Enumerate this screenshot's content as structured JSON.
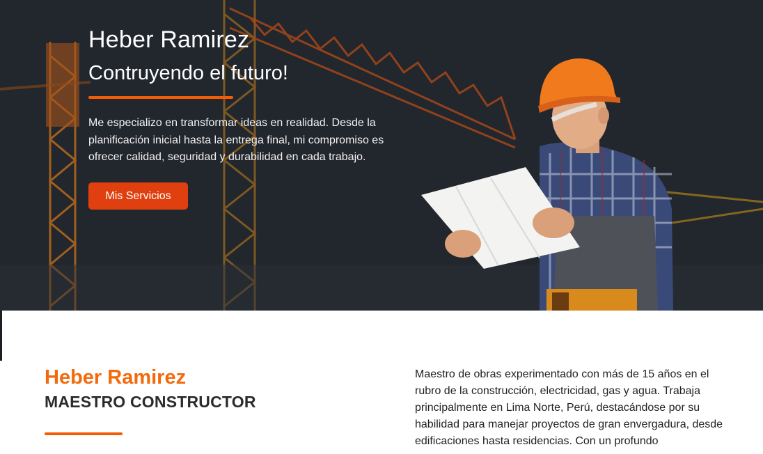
{
  "hero": {
    "title": "Heber Ramirez",
    "subtitle": "Contruyendo el futuro!",
    "description": "Me especializo en transformar ideas en realidad. Desde la planificación inicial hasta la entrega final, mi compromiso es ofrecer calidad, seguridad y durabilidad en cada trabajo.",
    "button_label": "Mis Servicios",
    "accent_color": "#f25c05",
    "button_color": "#e0400f"
  },
  "about": {
    "name": "Heber Ramirez",
    "role": "MAESTRO CONSTRUCTOR",
    "text": "Maestro de obras experimentado con más de 15 años en el rubro de la construcción, electricidad, gas y agua. Trabaja principalmente en Lima Norte, Perú, destacándose por su habilidad para manejar proyectos de gran envergadura, desde edificaciones hasta residencias. Con un profundo",
    "name_color": "#f26a0c"
  }
}
